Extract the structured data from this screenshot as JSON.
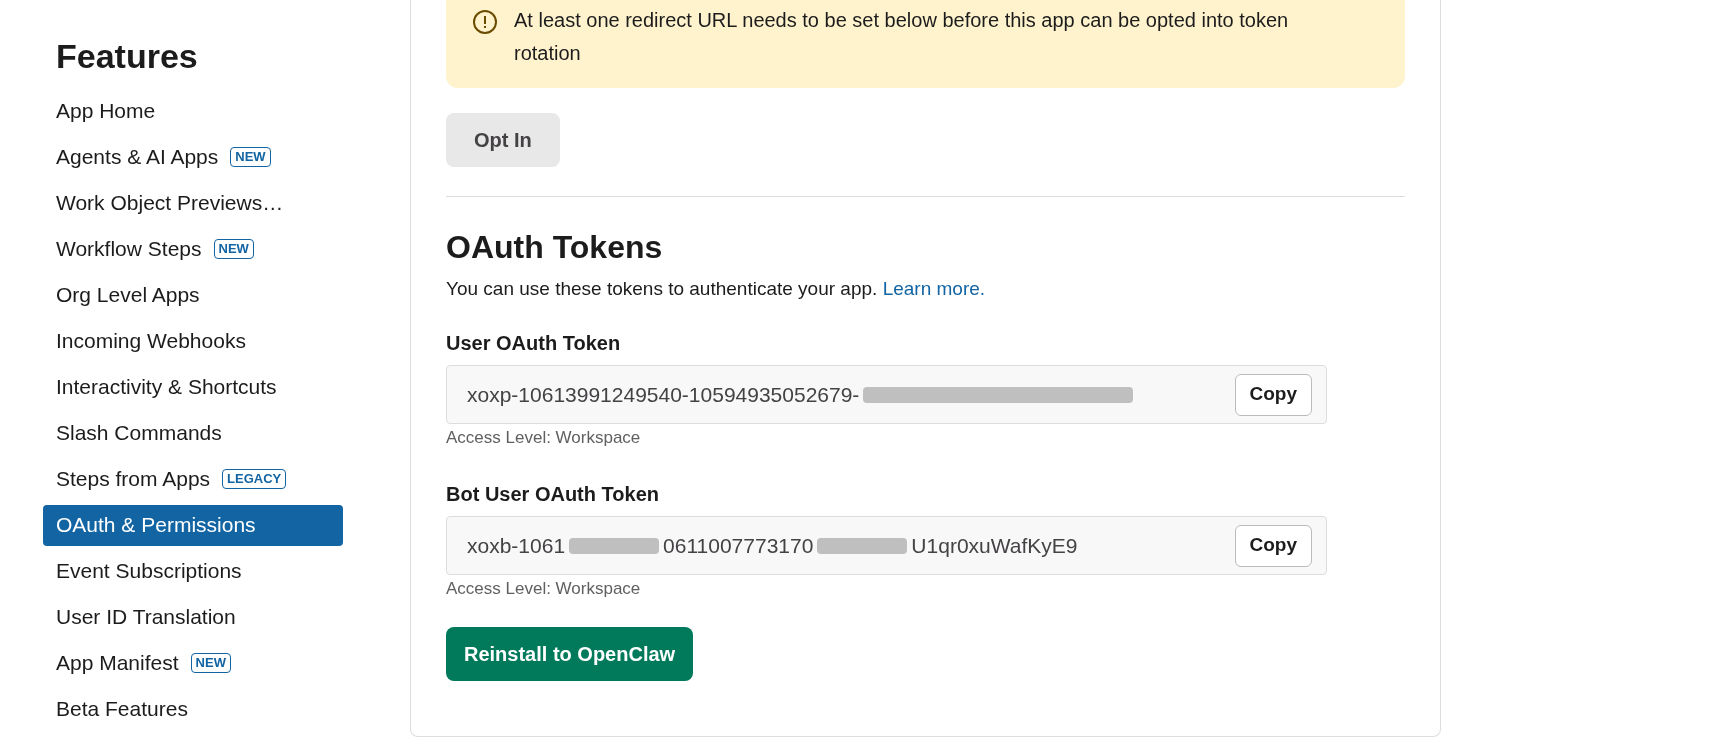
{
  "sidebar": {
    "heading": "Features",
    "items": [
      {
        "label": "App Home",
        "selected": false
      },
      {
        "label": "Agents & AI Apps",
        "badge": "NEW",
        "selected": false
      },
      {
        "label": "Work Object Previews…",
        "selected": false
      },
      {
        "label": "Workflow Steps",
        "badge": "NEW",
        "selected": false
      },
      {
        "label": "Org Level Apps",
        "selected": false
      },
      {
        "label": "Incoming Webhooks",
        "selected": false
      },
      {
        "label": "Interactivity & Shortcuts",
        "selected": false
      },
      {
        "label": "Slash Commands",
        "selected": false
      },
      {
        "label": "Steps from Apps",
        "badge": "LEGACY",
        "selected": false
      },
      {
        "label": "OAuth & Permissions",
        "selected": true
      },
      {
        "label": "Event Subscriptions",
        "selected": false
      },
      {
        "label": "User ID Translation",
        "selected": false
      },
      {
        "label": "App Manifest",
        "badge": "NEW",
        "selected": false
      },
      {
        "label": "Beta Features",
        "selected": false
      }
    ]
  },
  "warning": {
    "text": "At least one redirect URL needs to be set below before this app can be opted into token rotation"
  },
  "opt_in_button": "Opt In",
  "oauth_tokens": {
    "title": "OAuth Tokens",
    "description": "You can use these tokens to authenticate your app.",
    "link": "Learn more.",
    "tokens": [
      {
        "label": "User OAuth Token",
        "value_parts": [
          "xoxp-10613991249540-10594935052679-"
        ],
        "copy": "Copy",
        "access": "Access Level: Workspace"
      },
      {
        "label": "Bot User OAuth Token",
        "value_parts": [
          "xoxb-1061",
          "0611007773170",
          "U1qr0xuWafKyE9"
        ],
        "copy": "Copy",
        "access": "Access Level: Workspace"
      }
    ]
  },
  "reinstall_button": "Reinstall to OpenClaw"
}
